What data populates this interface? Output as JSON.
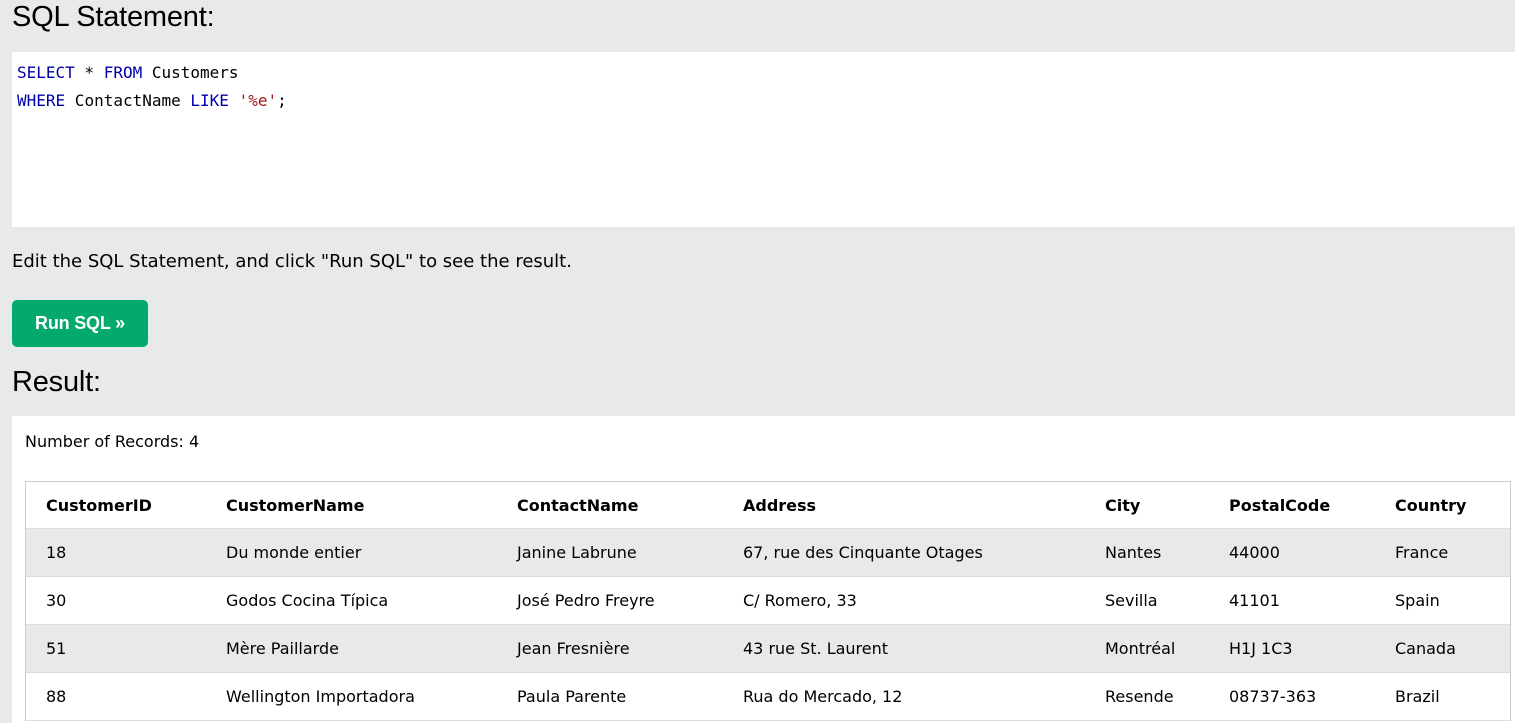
{
  "sql_heading": "SQL Statement:",
  "editor": {
    "line1": {
      "kw1": "SELECT",
      "op": " * ",
      "kw2": "FROM",
      "rest": " Customers"
    },
    "line2": {
      "kw1": "WHERE",
      "mid": " ContactName ",
      "kw2": "LIKE",
      "sp": " ",
      "str": "'%e'",
      "end": ";"
    }
  },
  "instructions": "Edit the SQL Statement, and click \"Run SQL\" to see the result.",
  "run_button_label": "Run SQL »",
  "result_heading": "Result:",
  "record_count_text": "Number of Records: 4",
  "colors": {
    "accent": "#04aa6d",
    "background": "#e7e9eb",
    "keyword": "#0000aa",
    "string": "#a31515"
  },
  "table": {
    "columns": [
      "CustomerID",
      "CustomerName",
      "ContactName",
      "Address",
      "City",
      "PostalCode",
      "Country"
    ],
    "rows": [
      [
        "18",
        "Du monde entier",
        "Janine Labrune",
        "67, rue des Cinquante Otages",
        "Nantes",
        "44000",
        "France"
      ],
      [
        "30",
        "Godos Cocina Típica",
        "José Pedro Freyre",
        "C/ Romero, 33",
        "Sevilla",
        "41101",
        "Spain"
      ],
      [
        "51",
        "Mère Paillarde",
        "Jean Fresnière",
        "43 rue St. Laurent",
        "Montréal",
        "H1J 1C3",
        "Canada"
      ],
      [
        "88",
        "Wellington Importadora",
        "Paula Parente",
        "Rua do Mercado, 12",
        "Resende",
        "08737-363",
        "Brazil"
      ]
    ]
  }
}
